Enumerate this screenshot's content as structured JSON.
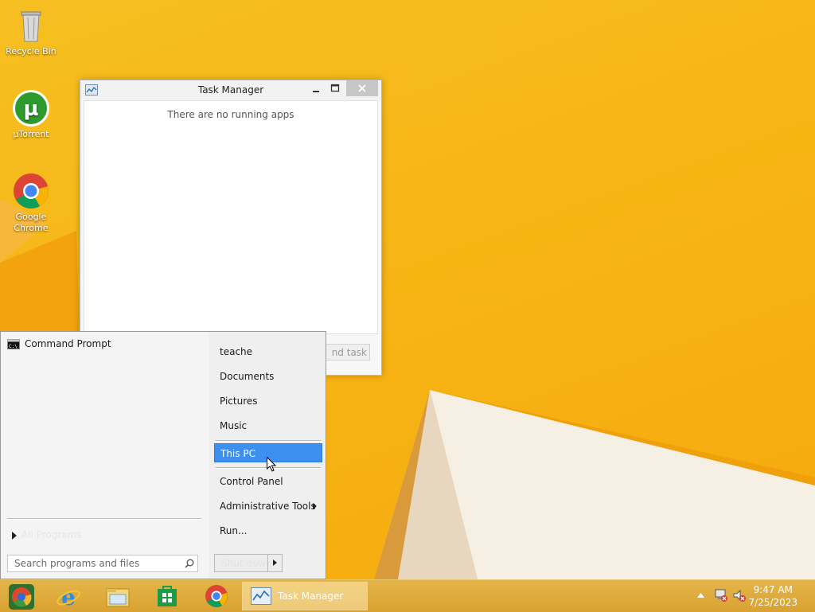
{
  "desktop": {
    "icons": [
      {
        "label": "Recycle Bin"
      },
      {
        "label": "µTorrent"
      },
      {
        "label": "Google Chrome"
      }
    ]
  },
  "task_manager": {
    "title": "Task Manager",
    "empty_message": "There are no running apps",
    "end_task_label": "nd task"
  },
  "start_menu": {
    "programs": [
      {
        "label": "Command Prompt",
        "icon": "command-prompt-icon"
      }
    ],
    "all_programs_label": "All Programs",
    "search_placeholder": "Search programs and files",
    "right_items": [
      {
        "label": "teache"
      },
      {
        "label": "Documents"
      },
      {
        "label": "Pictures"
      },
      {
        "label": "Music"
      },
      {
        "label": "This PC",
        "selected": true
      },
      {
        "label": "Control Panel"
      },
      {
        "label": "Administrative Tools"
      },
      {
        "label": "Run..."
      }
    ],
    "shutdown_label": "Shut down"
  },
  "taskbar": {
    "active_window_label": "Task Manager",
    "time": "9:47 AM",
    "date": "7/25/2023"
  },
  "colors": {
    "desktop": "#f7b615",
    "selection": "#3d8ff0",
    "taskbar": "#d9a233"
  }
}
